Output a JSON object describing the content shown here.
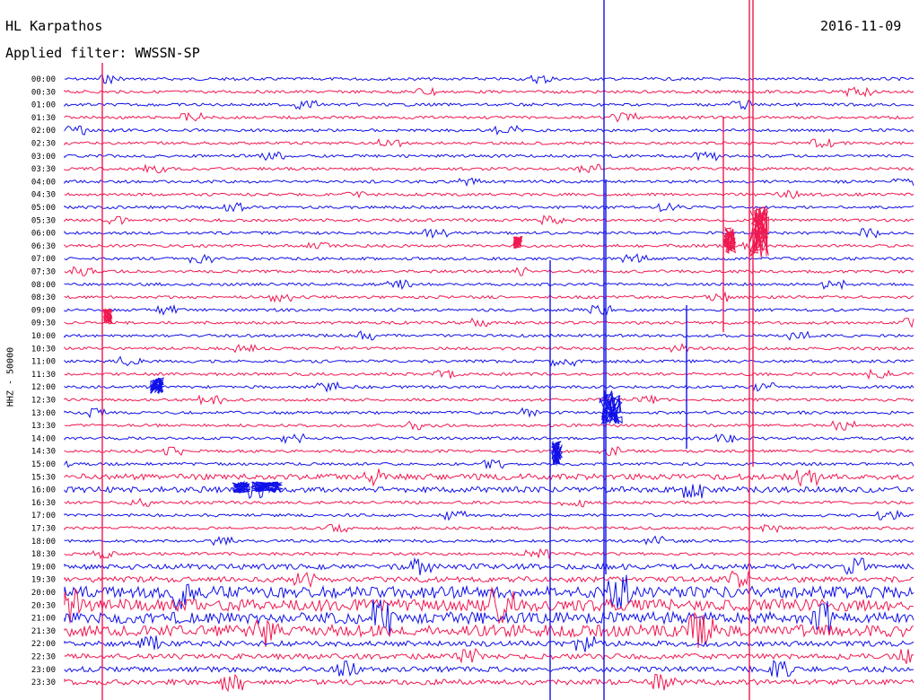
{
  "header": {
    "station": "HL Karpathos",
    "date": "2016-11-09",
    "filter_label": "Applied filter: WWSSN-SP"
  },
  "channel_label": "HHZ - 50000",
  "colors": {
    "trace_a": "#1010e8",
    "trace_b": "#f01850"
  },
  "traces": {
    "start_labels": [
      "00:00",
      "00:30",
      "01:00",
      "01:30",
      "02:00",
      "02:30",
      "03:00",
      "03:30",
      "04:00",
      "04:30",
      "05:00",
      "05:30",
      "06:00",
      "06:30",
      "07:00",
      "07:30",
      "08:00",
      "08:30",
      "09:00",
      "09:30",
      "10:00",
      "10:30",
      "11:00",
      "11:30",
      "12:00",
      "12:30",
      "13:00",
      "13:30",
      "14:00",
      "14:30",
      "15:00",
      "15:30",
      "16:00",
      "16:30",
      "17:00",
      "17:30",
      "18:00",
      "18:30",
      "19:00",
      "19:30",
      "20:00",
      "20:30",
      "21:00",
      "21:30",
      "22:00",
      "22:30",
      "23:00",
      "23:30"
    ]
  }
}
